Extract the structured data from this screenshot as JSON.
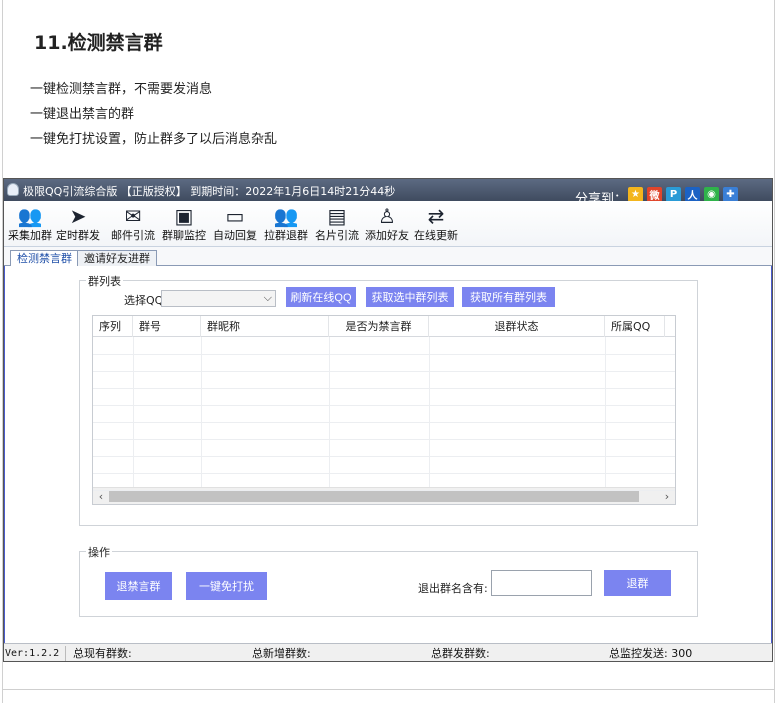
{
  "doc": {
    "title": "11.检测禁言群",
    "lines": [
      "一键检测禁言群，不需要发消息",
      "一键退出禁言的群",
      "一键免打扰设置，防止群多了以后消息杂乱"
    ]
  },
  "window": {
    "title": "极限QQ引流综合版 【正版授权】 到期时间：2022年1月6日14时21分44秒",
    "share_label": "分享到："
  },
  "share_icons": [
    {
      "name": "qzone-icon",
      "glyph": "★",
      "color": "#f3b51d"
    },
    {
      "name": "weibo-icon",
      "glyph": "微",
      "color": "#e0452b"
    },
    {
      "name": "pengyou-icon",
      "glyph": "P",
      "color": "#2a9bd6"
    },
    {
      "name": "renren-icon",
      "glyph": "人",
      "color": "#1b62c4"
    },
    {
      "name": "wechat-icon",
      "glyph": "◉",
      "color": "#2fb34a"
    },
    {
      "name": "tqq-icon",
      "glyph": "✚",
      "color": "#3a7fd6"
    }
  ],
  "toolbar": [
    {
      "label": "采集加群",
      "glyph": "👥",
      "icon": "collect-groups-icon"
    },
    {
      "label": "定时群发",
      "glyph": "➤",
      "icon": "paper-plane-icon"
    },
    {
      "label": "邮件引流",
      "glyph": "✉",
      "icon": "mail-icon"
    },
    {
      "label": "群聊监控",
      "glyph": "▣",
      "icon": "monitor-icon"
    },
    {
      "label": "自动回复",
      "glyph": "▭",
      "icon": "auto-reply-icon"
    },
    {
      "label": "拉群退群",
      "glyph": "👥",
      "icon": "pull-exit-group-icon"
    },
    {
      "label": "名片引流",
      "glyph": "▤",
      "icon": "name-card-icon"
    },
    {
      "label": "添加好友",
      "glyph": "♙",
      "icon": "add-friend-icon"
    },
    {
      "label": "在线更新",
      "glyph": "⇄",
      "icon": "refresh-update-icon"
    }
  ],
  "tabs": [
    {
      "label": "检测禁言群",
      "active": true
    },
    {
      "label": "邀请好友进群",
      "active": false
    }
  ],
  "group_list": {
    "title": "群列表",
    "select_label": "选择QQ:",
    "select_value": "",
    "buttons": {
      "refresh": "刷新在线QQ",
      "get_selected": "获取选中群列表",
      "get_all": "获取所有群列表"
    },
    "columns": [
      "序列",
      "群号",
      "群昵称",
      "是否为禁言群",
      "退群状态",
      "所属QQ"
    ]
  },
  "ops": {
    "title": "操作",
    "exit_muted": "退禁言群",
    "mute_all": "一键免打扰",
    "exit_label": "退出群名含有:",
    "exit_value": "",
    "exit_button": "退群"
  },
  "status": {
    "version": "Ver:1.2.2",
    "total_groups": "总现有群数:",
    "new_groups": "总新增群数:",
    "sent_groups": "总群发群数:",
    "monitor_sent": "总监控发送: 300"
  }
}
